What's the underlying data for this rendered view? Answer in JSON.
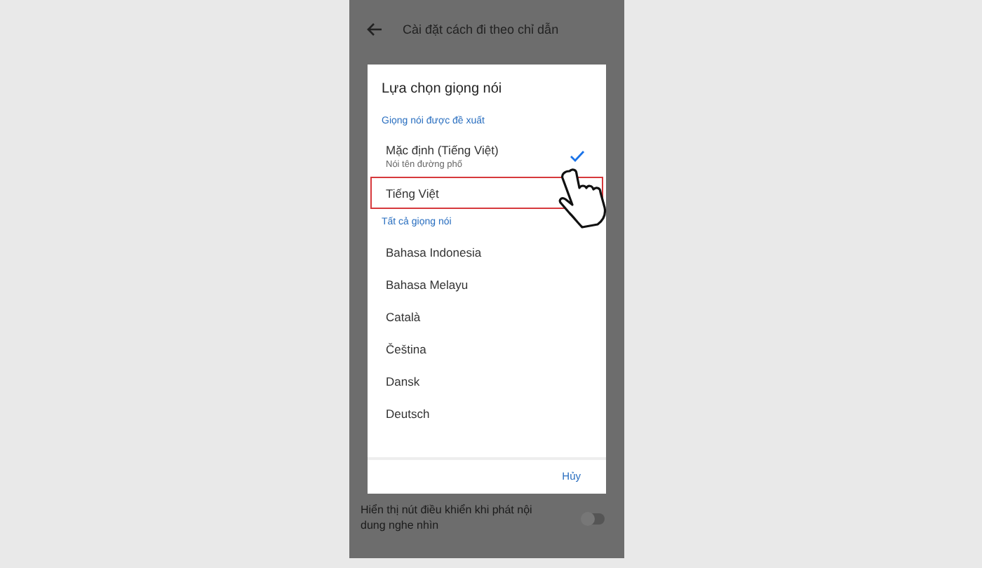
{
  "screen": {
    "title": "Cài đặt cách đi theo chỉ dẫn",
    "setting": {
      "label": "Hiển thị nút điều khiển khi phát nội dung nghe nhìn",
      "on": false
    }
  },
  "dialog": {
    "title": "Lựa chọn giọng nói",
    "sections": [
      {
        "heading": "Giọng nói được đề xuất",
        "items": [
          {
            "label": "Mặc định (Tiếng Việt)",
            "subtitle": "Nói tên đường phố",
            "selected": true,
            "highlighted": false
          },
          {
            "label": "Tiếng Việt",
            "selected": false,
            "highlighted": true
          }
        ]
      },
      {
        "heading": "Tất cả giọng nói",
        "items": [
          {
            "label": "Bahasa Indonesia",
            "selected": false,
            "highlighted": false
          },
          {
            "label": "Bahasa Melayu",
            "selected": false,
            "highlighted": false
          },
          {
            "label": "Català",
            "selected": false,
            "highlighted": false
          },
          {
            "label": "Čeština",
            "selected": false,
            "highlighted": false
          },
          {
            "label": "Dansk",
            "selected": false,
            "highlighted": false
          },
          {
            "label": "Deutsch",
            "selected": false,
            "highlighted": false
          }
        ]
      }
    ],
    "cancel": "Hủy"
  }
}
